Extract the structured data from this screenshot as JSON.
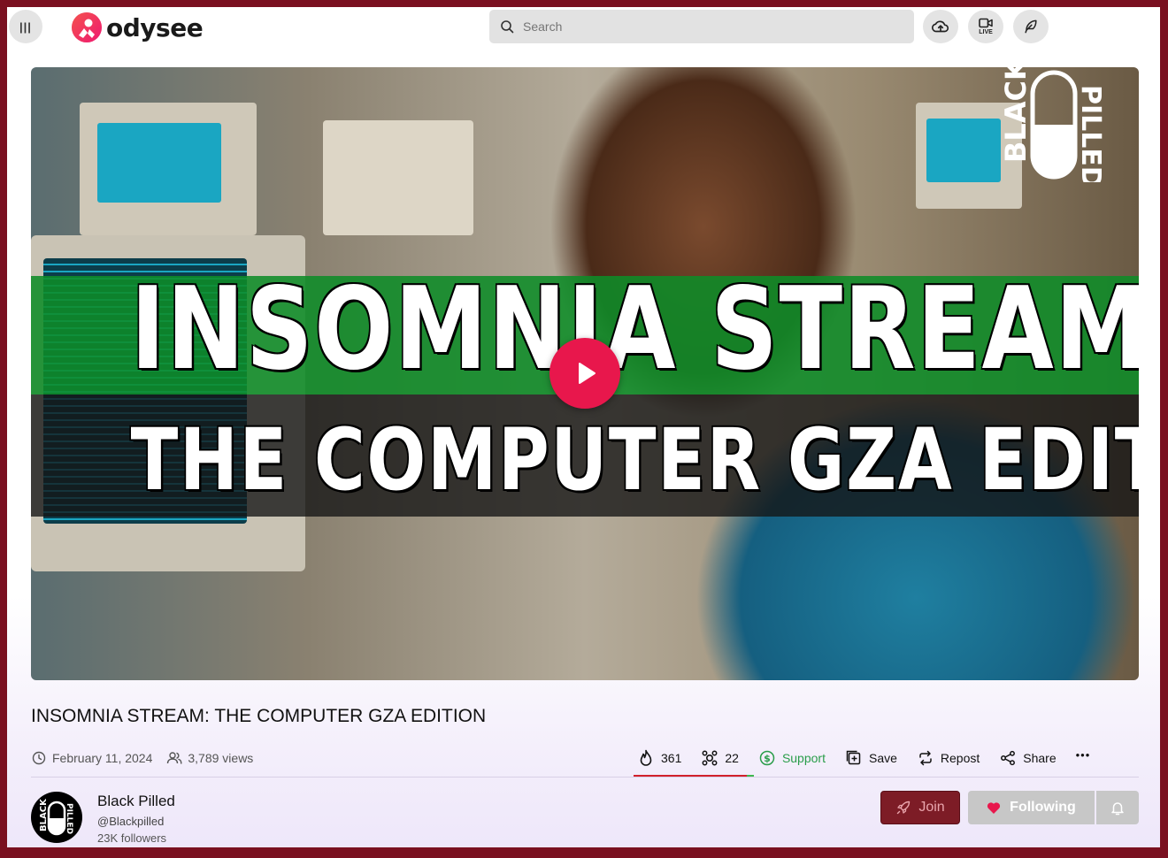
{
  "header": {
    "logo_text": "odysee",
    "search_placeholder": "Search",
    "live_label": "LIVE"
  },
  "video": {
    "thumbnail_line1": "INSOMNIA STREAM",
    "thumbnail_line2": "THE COMPUTER GZA EDITION",
    "brand_mark_left": "BLACK",
    "brand_mark_right": "PILLED"
  },
  "details": {
    "title": "INSOMNIA STREAM: THE COMPUTER GZA EDITION",
    "date": "February 11, 2024",
    "views": "3,789 views"
  },
  "actions": {
    "fire_count": "361",
    "slime_count": "22",
    "support_label": "Support",
    "save_label": "Save",
    "repost_label": "Repost",
    "share_label": "Share",
    "more_label": "•••",
    "like_ratio": 0.94
  },
  "channel": {
    "name": "Black Pilled",
    "handle": "@Blackpilled",
    "followers": "23K followers",
    "avatar_left": "BLACK",
    "avatar_right": "PILLED",
    "join_label": "Join",
    "follow_label": "Following"
  },
  "colors": {
    "accent": "#e8174c",
    "support": "#2a9d4a",
    "join_bg": "#7d1c26",
    "follow_bg": "#c7c7c7"
  }
}
